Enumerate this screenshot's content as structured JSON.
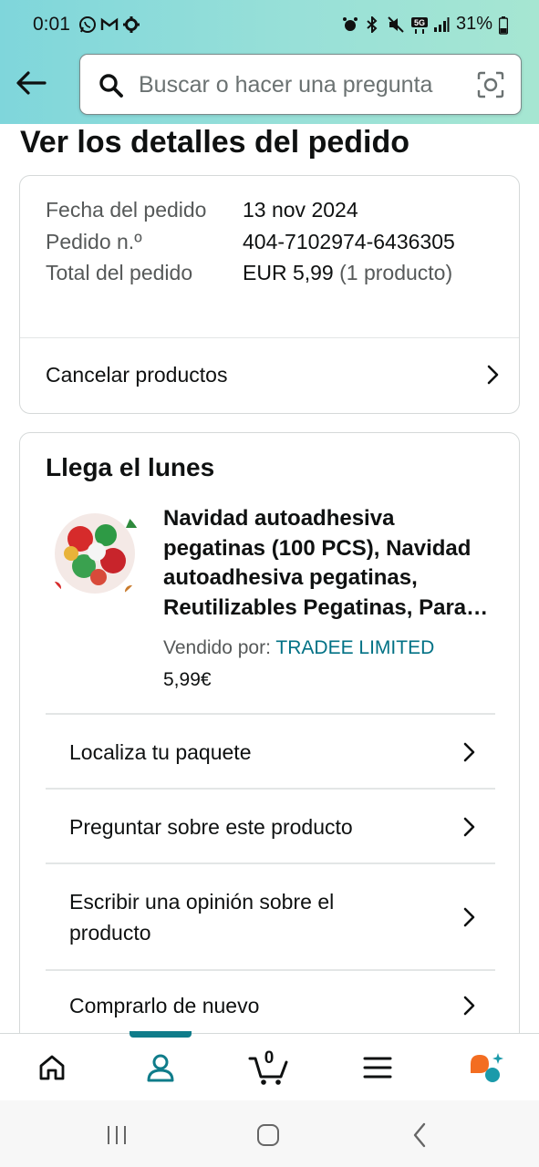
{
  "status_bar": {
    "time": "0:01",
    "left_icons": [
      "whatsapp-icon",
      "gmail-icon",
      "settings-icon"
    ],
    "right_icons": [
      "alarm-icon",
      "bluetooth-icon",
      "mute-icon",
      "5g-icon",
      "signal-icon"
    ],
    "battery": "31%"
  },
  "header": {
    "search_placeholder": "Buscar o hacer una pregunta",
    "background_gradient": [
      "#7fd6db",
      "#a6e6d2"
    ]
  },
  "page": {
    "title": "Ver los detalles del pedido"
  },
  "order_summary": {
    "date_label": "Fecha del pedido",
    "date_value": "13 nov 2024",
    "number_label": "Pedido n.º",
    "number_value": "404-7102974-6436305",
    "total_label": "Total del pedido",
    "total_value": "EUR 5,99",
    "total_count": "(1 producto)",
    "cancel_label": "Cancelar productos"
  },
  "shipment": {
    "heading": "Llega el lunes",
    "product": {
      "title": "Navidad autoadhesiva pegatinas (100 PCS), Navidad autoadhesiva pegatinas, Reutilizables Pegatinas, Para…",
      "seller_label": "Vendido por:",
      "seller_name": "TRADEE LIMITED",
      "price": "5,99€"
    },
    "actions": [
      {
        "label": "Localiza tu paquete"
      },
      {
        "label": "Preguntar sobre este producto"
      },
      {
        "label": "Escribir una opinión sobre el producto"
      },
      {
        "label": "Comprarlo de nuevo"
      }
    ]
  },
  "bottom_nav": {
    "items": [
      "home-icon",
      "account-icon",
      "cart-icon",
      "menu-icon",
      "rufus-icon"
    ],
    "active": "account-icon",
    "cart_count": "0",
    "accent": "#0f7c8a"
  },
  "colors": {
    "link": "#007185",
    "accent_orange": "#f36d21",
    "accent_teal": "#1b9aaa"
  }
}
